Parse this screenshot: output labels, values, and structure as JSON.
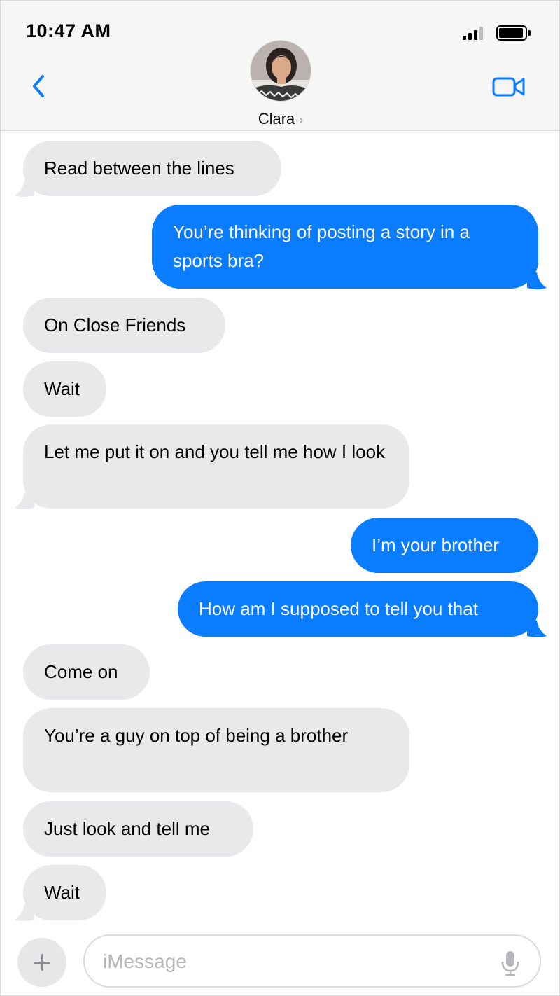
{
  "status_bar": {
    "time": "10:47 AM"
  },
  "header": {
    "contact_name": "Clara",
    "contact_chevron": "›"
  },
  "messages": [
    {
      "from": "them",
      "text": "Read between the lines"
    },
    {
      "from": "me",
      "text": "You’re thinking of posting a story in a sports bra?"
    },
    {
      "from": "them",
      "text": "On Close Friends"
    },
    {
      "from": "them",
      "text": "Wait"
    },
    {
      "from": "them",
      "text": "Let me put it on and you tell me how I look"
    },
    {
      "from": "me",
      "text": "I’m your brother"
    },
    {
      "from": "me",
      "text": "How am I supposed to tell you that"
    },
    {
      "from": "them",
      "text": "Come on"
    },
    {
      "from": "them",
      "text": "You’re a guy on top of being a brother"
    },
    {
      "from": "them",
      "text": "Just look and tell me"
    },
    {
      "from": "them",
      "text": "Wait"
    }
  ],
  "composer": {
    "placeholder": "iMessage"
  },
  "icons": {
    "back": "chevron-left-icon",
    "video": "video-camera-icon",
    "add": "plus-icon",
    "mic": "microphone-icon",
    "signal": "signal-icon",
    "battery": "battery-icon"
  },
  "colors": {
    "accent": "#0a7cff",
    "received_bubble": "#e9e9eb",
    "header_bg": "#f6f6f6"
  }
}
